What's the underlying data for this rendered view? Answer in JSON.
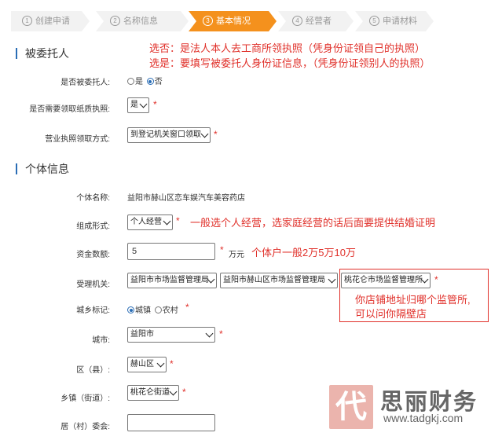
{
  "steps": [
    {
      "num": "1",
      "label": "创建申请"
    },
    {
      "num": "2",
      "label": "名称信息"
    },
    {
      "num": "3",
      "label": "基本情况"
    },
    {
      "num": "4",
      "label": "经营者"
    },
    {
      "num": "5",
      "label": "申请材料"
    }
  ],
  "annotations": {
    "top_line1": "选否：是法人本人去工商所领执照（凭身份证领自己的执照）",
    "top_line2": "选是：要填写被委托人身份证信息，（凭身份证领别人的执照）",
    "zuchengxingshi_note": "一般选个人经营，选家庭经营的话后面要提供结婚证明",
    "zijin_note": "个体户一般2万5万10万",
    "jianguansuo_note_line1": "你店铺地址归哪个监管所,",
    "jianguansuo_note_line2": "可以问你隔壁店"
  },
  "section1": {
    "title": "被委托人",
    "fields": {
      "is_entrusted_label": "是否被委托人:",
      "opt_yes": "是",
      "opt_no": "否",
      "need_paper_label": "是否需要领取纸质执照:",
      "need_paper_value": "是",
      "receive_method_label": "营业执照领取方式:",
      "receive_method_value": "到登记机关窗口领取"
    }
  },
  "section2": {
    "title": "个体信息",
    "fields": {
      "name_label": "个体名称:",
      "name_value": "益阳市赫山区恋车娱汽车美容药店",
      "form_label": "组成形式:",
      "form_value": "个人经营",
      "capital_label": "资金数额:",
      "capital_value": "5",
      "capital_unit": "万元",
      "authority_label": "受理机关:",
      "authority_1": "益阳市市场监督管理局",
      "authority_2": "益阳市赫山区市场监督管理局",
      "authority_3": "桃花仑市场监督管理所",
      "urban_label": "城乡标记:",
      "urban_opt1": "城镇",
      "urban_opt2": "农村",
      "city_label": "城市:",
      "city_value": "益阳市",
      "district_label": "区（县）:",
      "district_value": "赫山区",
      "town_label": "乡镇（街道）:",
      "town_value": "桃花仑街道",
      "village_label": "居（村）委会:"
    }
  },
  "watermark": {
    "brand": "思丽财务",
    "url": "www.tadgkj.com",
    "logo_char": "代"
  },
  "colors": {
    "accent": "#f4911d",
    "red": "#e0302a",
    "blue": "#2a6db5"
  }
}
